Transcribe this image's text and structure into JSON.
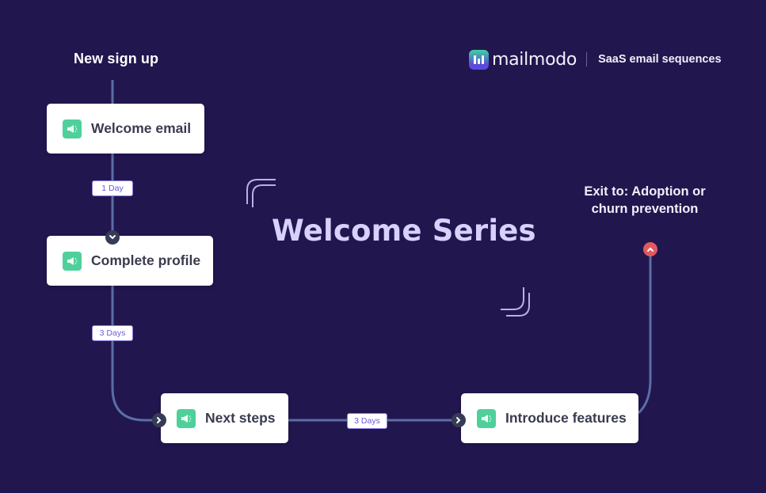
{
  "brand": {
    "name": "mailmodo",
    "tagline": "SaaS email sequences",
    "colors": {
      "logo_top": "#3fd3a0",
      "logo_bottom": "#6247e0"
    }
  },
  "title": "Welcome Series",
  "start": {
    "label": "New sign up"
  },
  "exit": {
    "label": "Exit to: Adoption or churn prevention"
  },
  "nodes": [
    {
      "label": "Welcome email",
      "icon": "megaphone-icon"
    },
    {
      "label": "Complete profile",
      "icon": "megaphone-icon"
    },
    {
      "label": "Next steps",
      "icon": "megaphone-icon"
    },
    {
      "label": "Introduce features",
      "icon": "megaphone-icon"
    }
  ],
  "delays": [
    {
      "label": "1 Day"
    },
    {
      "label": "3 Days"
    },
    {
      "label": "3 Days"
    }
  ],
  "colors": {
    "background": "#22164f",
    "connector": "#5b6ea6",
    "node_icon": "#4fd09b",
    "delay_text": "#6c5ad6",
    "exit_handle": "#e05a60",
    "title": "#d7d1fb"
  }
}
